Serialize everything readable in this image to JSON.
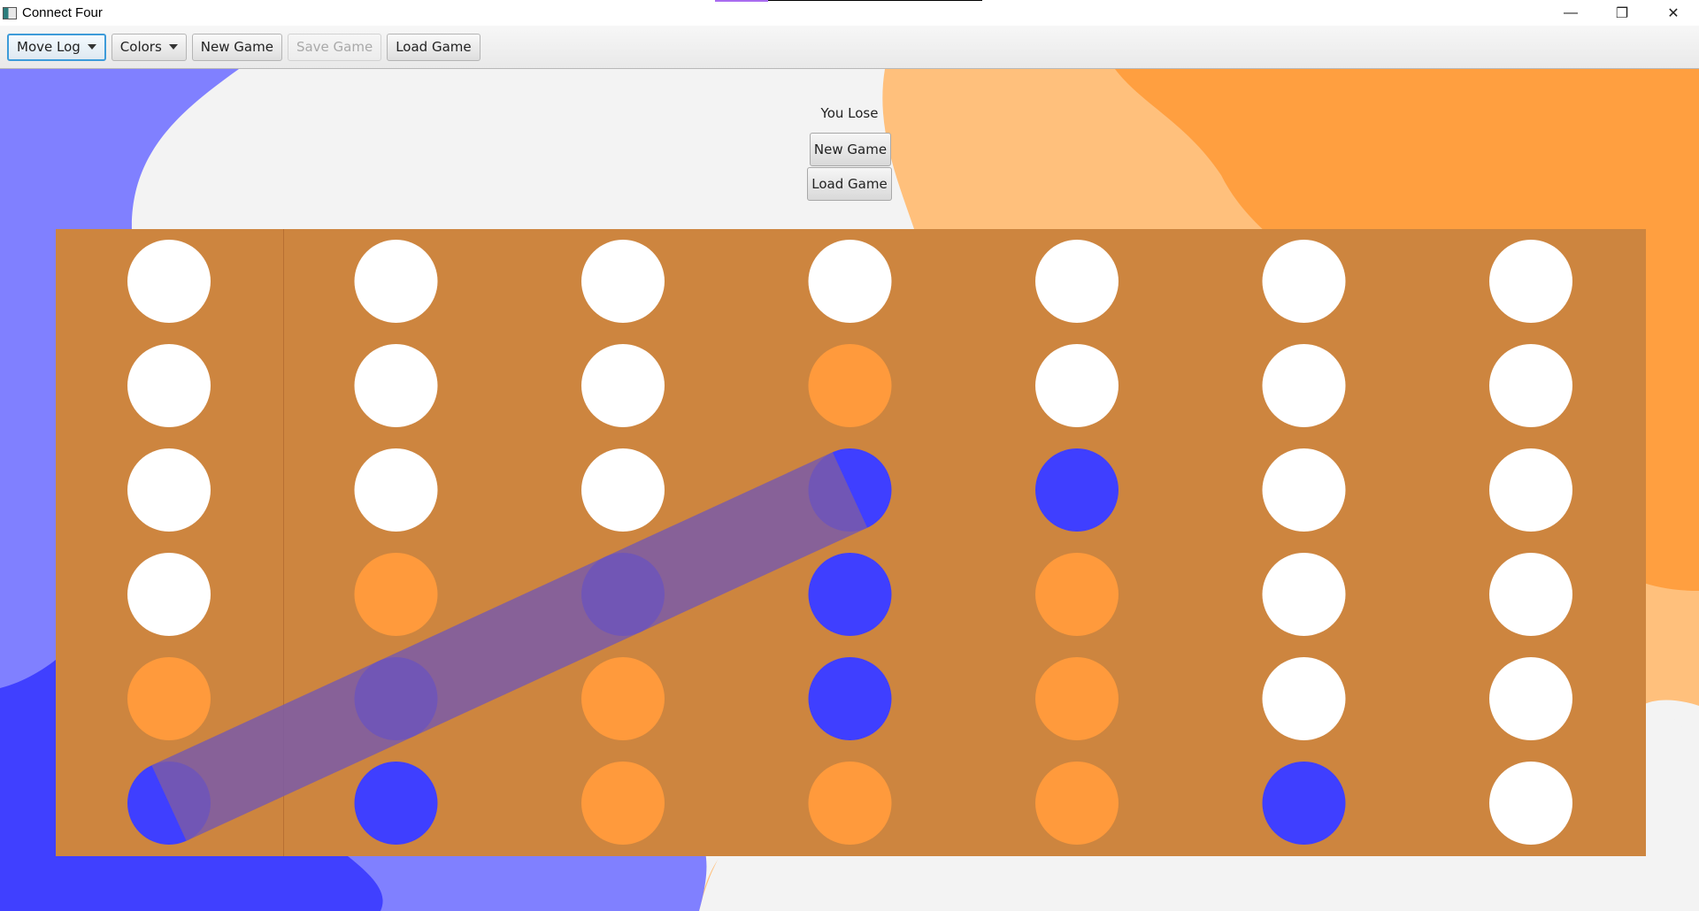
{
  "window": {
    "title": "Connect Four",
    "controls": {
      "minimize": "—",
      "maximize": "❐",
      "close": "✕"
    }
  },
  "toolbar": {
    "move_log": "Move Log",
    "colors": "Colors",
    "new_game": "New Game",
    "save_game": "Save Game",
    "load_game": "Load Game"
  },
  "status": {
    "message": "You Lose",
    "new_game": "New Game",
    "load_game": "Load Game"
  },
  "colors": {
    "board": "#cd853f",
    "empty": "#ffffff",
    "orange": "#ff9a3c",
    "blue": "#3f3fff",
    "win_line": "#7a5aa8"
  },
  "board": {
    "columns": 7,
    "rows": 6,
    "cells": [
      [
        "empty",
        "empty",
        "empty",
        "empty",
        "empty",
        "empty",
        "empty"
      ],
      [
        "empty",
        "empty",
        "empty",
        "orange",
        "empty",
        "empty",
        "empty"
      ],
      [
        "empty",
        "empty",
        "empty",
        "blue",
        "blue",
        "empty",
        "empty"
      ],
      [
        "empty",
        "orange",
        "blue",
        "blue",
        "orange",
        "empty",
        "empty"
      ],
      [
        "orange",
        "blue",
        "orange",
        "blue",
        "orange",
        "empty",
        "empty"
      ],
      [
        "blue",
        "blue",
        "orange",
        "orange",
        "orange",
        "blue",
        "empty"
      ]
    ],
    "winning_line": [
      [
        5,
        0
      ],
      [
        4,
        1
      ],
      [
        3,
        2
      ],
      [
        2,
        3
      ]
    ]
  }
}
